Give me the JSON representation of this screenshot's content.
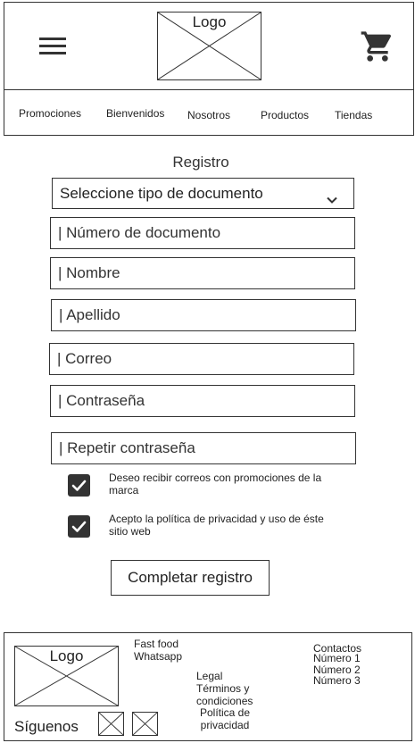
{
  "header": {
    "logo_label": "Logo",
    "menu_icon": "hamburger-menu-icon",
    "cart_icon": "shopping-cart-icon"
  },
  "nav": {
    "items": [
      {
        "label": "Promociones"
      },
      {
        "label": "Bienvenidos"
      },
      {
        "label": "Nosotros"
      },
      {
        "label": "Productos"
      },
      {
        "label": "Tiendas"
      }
    ]
  },
  "form": {
    "title": "Registro",
    "document_type": {
      "value": "Seleccione tipo de documento",
      "icon": "chevron-down-icon"
    },
    "fields": {
      "document_number": "| Número de documento",
      "first_name": "| Nombre",
      "last_name": "| Apellido",
      "email": "| Correo",
      "password": "| Contraseña",
      "password_repeat": "| Repetir contraseña"
    },
    "checkboxes": [
      {
        "label": "Deseo recibir correos con promociones de la marca",
        "checked": true
      },
      {
        "label": "Acepto la política de privacidad y uso de éste sitio web",
        "checked": true
      }
    ],
    "submit_label": "Completar registro"
  },
  "footer": {
    "logo_label": "Logo",
    "follow_label": "Síguenos",
    "links_col1": [
      "Fast food",
      "Whatsapp"
    ],
    "links_col2": [
      "Legal",
      "Términos y condiciones",
      "Política de privacidad"
    ],
    "contacts": {
      "title": "Contactos",
      "numbers": [
        "Número 1",
        "Número 2",
        "Número 3"
      ]
    },
    "social_icons": [
      "social-icon-placeholder",
      "social-icon-placeholder"
    ]
  },
  "colors": {
    "border": "#333333",
    "checkbox_fill": "#333333",
    "background": "#ffffff"
  }
}
